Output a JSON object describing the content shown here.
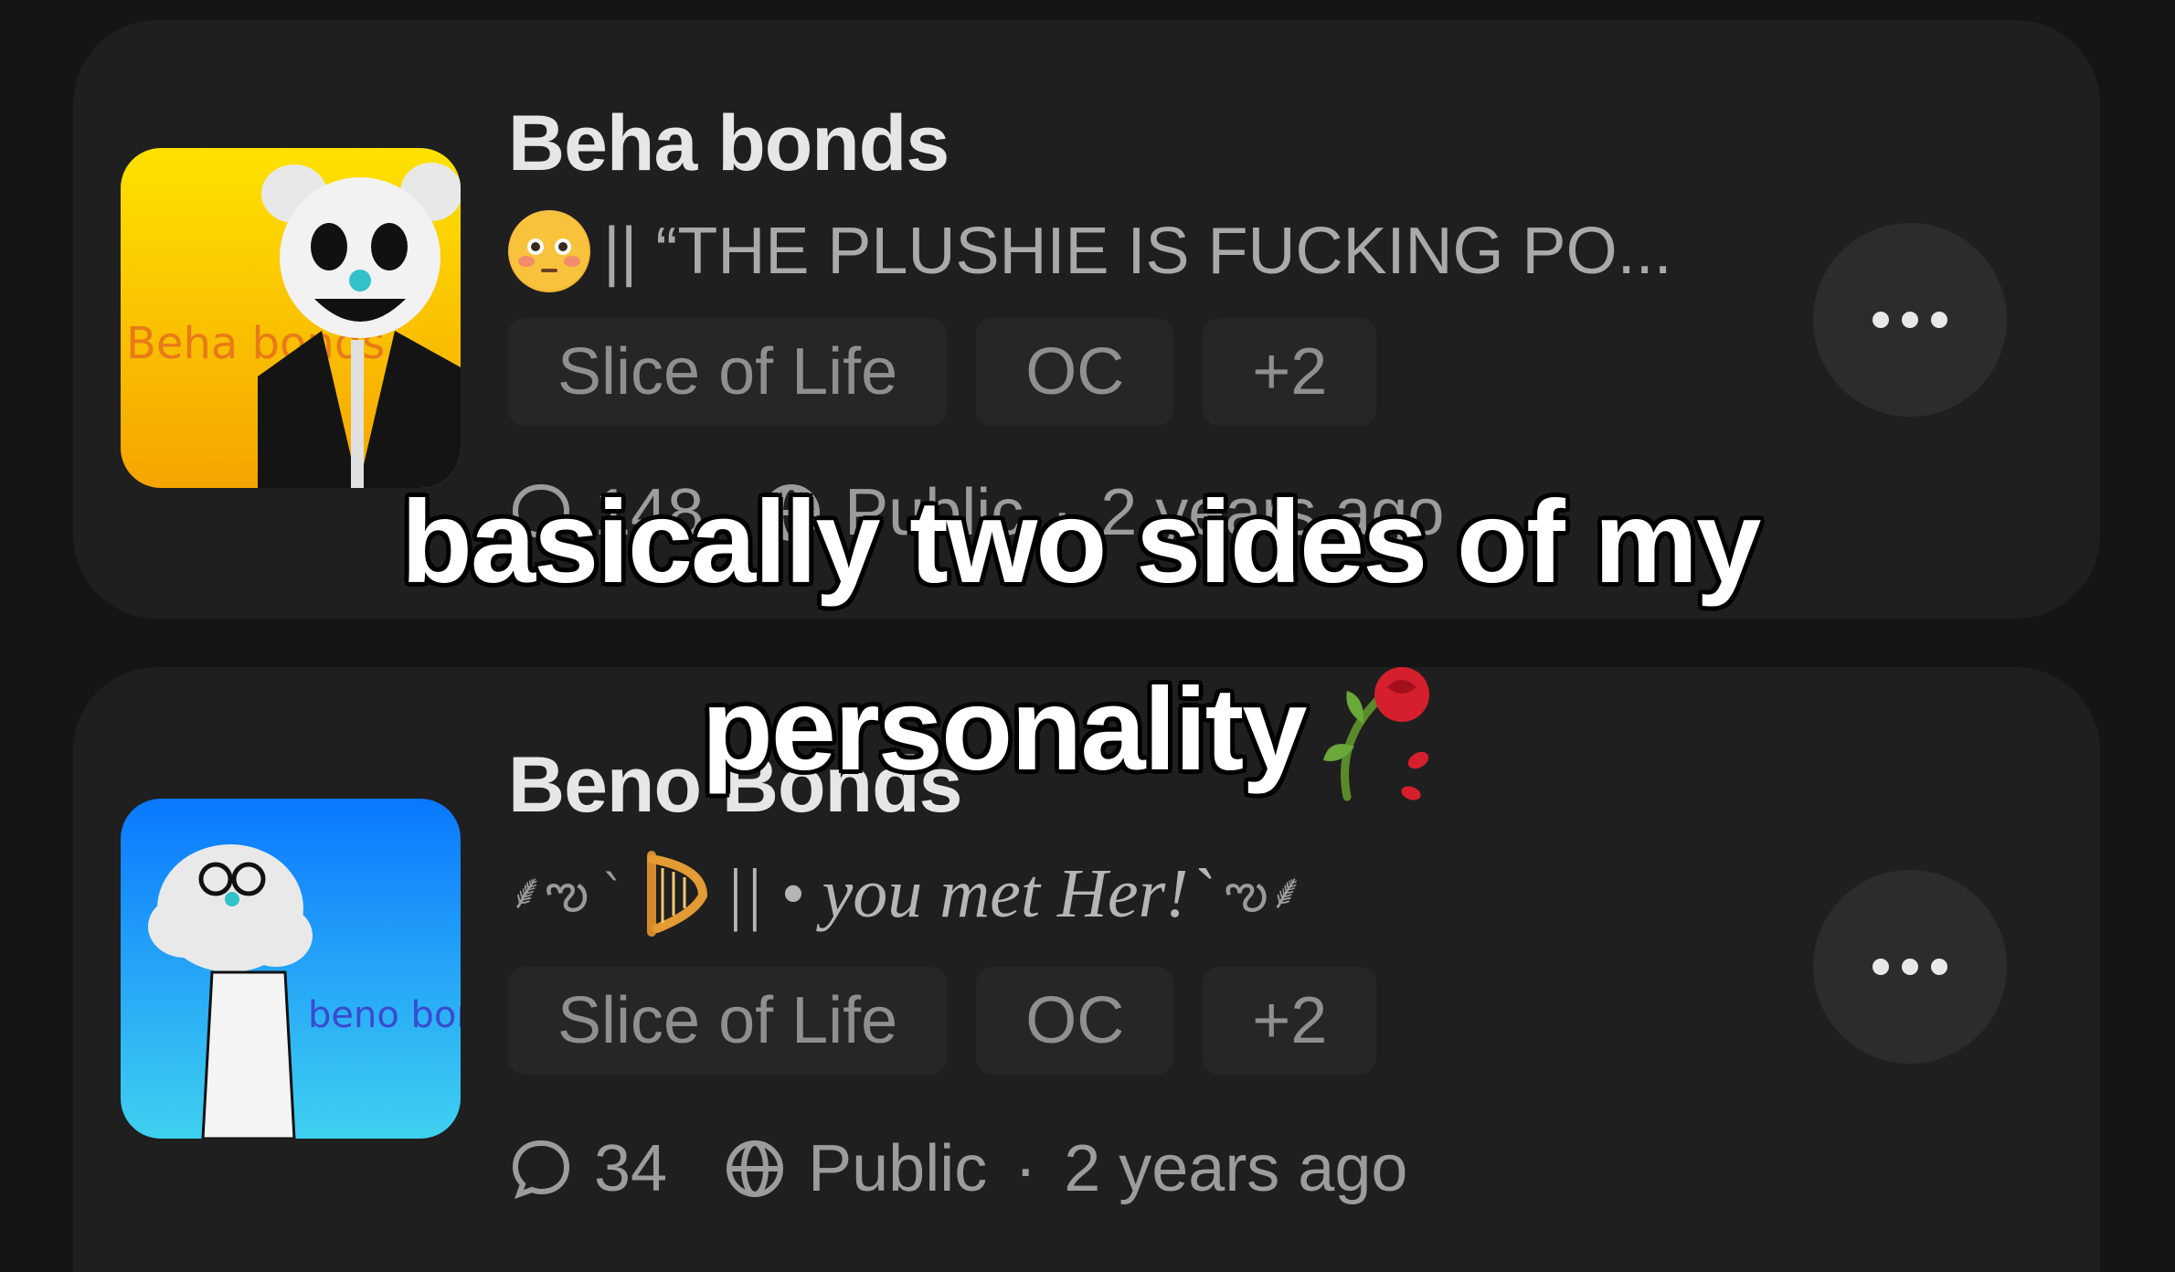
{
  "posts": [
    {
      "title": "Beha bonds",
      "greeting_text": "|| “THE PLUSHIE IS FUCKING PO...",
      "tags": [
        "Slice of Life",
        "OC",
        "+2"
      ],
      "comments": "148",
      "visibility": "Public",
      "time": "2 years ago",
      "avatar_text": "Beha bonds",
      "avatar_bg": "#f4c300"
    },
    {
      "title": "Beno Bonds",
      "greeting_prefix": "`",
      "greeting_text": "|| • you met Her!`",
      "tags": [
        "Slice of Life",
        "OC",
        "+2"
      ],
      "comments": "34",
      "visibility": "Public",
      "time": "2 years ago",
      "avatar_text": "beno bonds",
      "avatar_bg": "#1da9f2"
    }
  ],
  "icons": {
    "more": "more-horizontal-icon",
    "comment": "chat-bubble-icon",
    "visibility": "globe-icon",
    "greeting_1": "flushed-face-emoji",
    "greeting_2": "harp-emoji",
    "caption": "wilted-rose-emoji"
  },
  "caption": {
    "line1": "basically two sides of my",
    "line2": "personality"
  },
  "separator": "·"
}
